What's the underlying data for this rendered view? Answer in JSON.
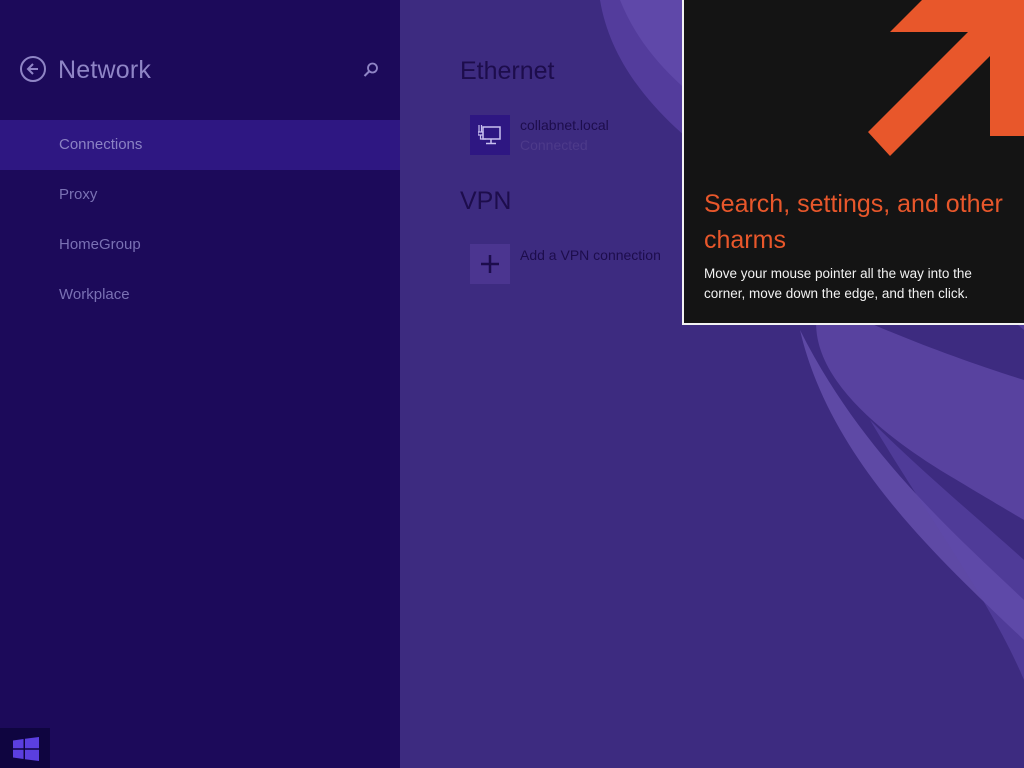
{
  "settings": {
    "title": "Network",
    "nav_items": [
      {
        "label": "Connections"
      },
      {
        "label": "Proxy"
      },
      {
        "label": "HomeGroup"
      },
      {
        "label": "Workplace"
      }
    ],
    "selected_nav": "Connections"
  },
  "ethernet": {
    "section_title": "Ethernet",
    "connection": {
      "name": "collabnet.local",
      "status": "Connected",
      "icon": "ethernet-monitor-icon"
    }
  },
  "vpn": {
    "section_title": "VPN",
    "add_label": "Add a VPN connection",
    "icon": "plus-icon"
  },
  "tip": {
    "title": "Search, settings, and other charms",
    "body": "Move your mouse pointer all the way into the corner, move down the edge, and then click.",
    "icon": "corner-arrow-icon"
  },
  "colors": {
    "accent": "#e8572b",
    "pane": "#1c0a5a",
    "selected": "#2e1782",
    "background": "#3c2a7e"
  }
}
